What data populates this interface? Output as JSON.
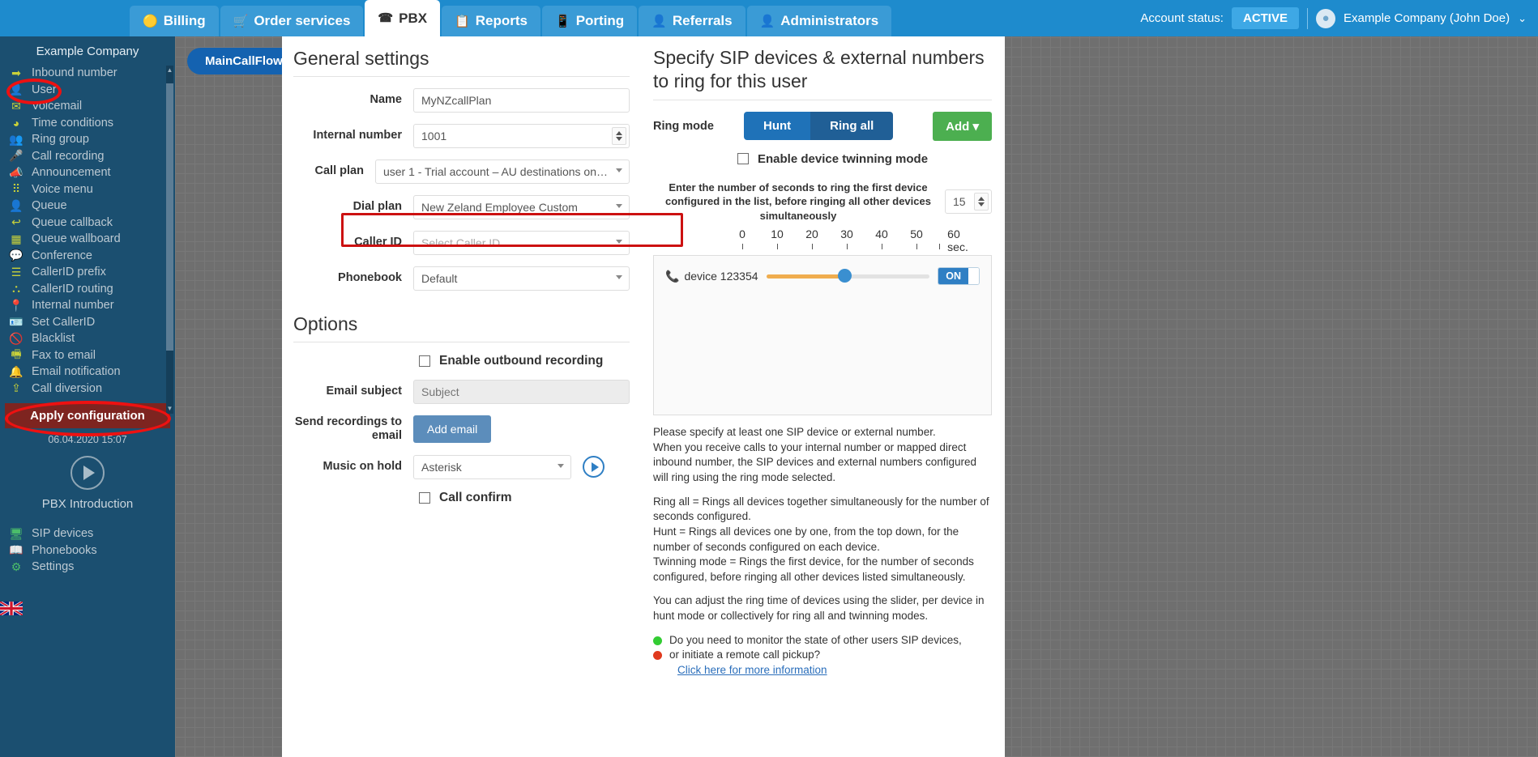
{
  "header": {
    "tabs": [
      {
        "label": "Billing",
        "icon": "wallet-icon",
        "active": false
      },
      {
        "label": "Order services",
        "icon": "cart-icon",
        "active": false
      },
      {
        "label": "PBX",
        "icon": "pbx-icon",
        "active": true
      },
      {
        "label": "Reports",
        "icon": "report-icon",
        "active": false
      },
      {
        "label": "Porting",
        "icon": "phone-icon",
        "active": false
      },
      {
        "label": "Referrals",
        "icon": "person-icon",
        "active": false
      },
      {
        "label": "Administrators",
        "icon": "admin-icon",
        "active": false
      }
    ],
    "account_status_label": "Account status:",
    "account_status_value": "ACTIVE",
    "user_name": "Example Company (John Doe)"
  },
  "sidebar": {
    "company": "Example Company",
    "items": [
      {
        "label": "Inbound number",
        "icon": "arrow-right-icon"
      },
      {
        "label": "User",
        "icon": "user-icon"
      },
      {
        "label": "Voicemail",
        "icon": "envelope-icon"
      },
      {
        "label": "Time conditions",
        "icon": "clock-icon"
      },
      {
        "label": "Ring group",
        "icon": "users-icon"
      },
      {
        "label": "Call recording",
        "icon": "microphone-icon"
      },
      {
        "label": "Announcement",
        "icon": "megaphone-icon"
      },
      {
        "label": "Voice menu",
        "icon": "grid-icon"
      },
      {
        "label": "Queue",
        "icon": "user-plus-icon"
      },
      {
        "label": "Queue callback",
        "icon": "reply-icon"
      },
      {
        "label": "Queue wallboard",
        "icon": "table-icon"
      },
      {
        "label": "Conference",
        "icon": "chat-icon"
      },
      {
        "label": "CallerID prefix",
        "icon": "list-icon"
      },
      {
        "label": "CallerID routing",
        "icon": "sitemap-icon"
      },
      {
        "label": "Internal number",
        "icon": "pin-icon"
      },
      {
        "label": "Set CallerID",
        "icon": "idcard-icon"
      },
      {
        "label": "Blacklist",
        "icon": "ban-icon"
      },
      {
        "label": "Fax to email",
        "icon": "fax-icon"
      },
      {
        "label": "Email notification",
        "icon": "bell-icon"
      },
      {
        "label": "Call diversion",
        "icon": "upload-icon"
      }
    ],
    "apply_button": "Apply configuration",
    "timestamp": "06.04.2020 15:07",
    "intro_label": "PBX Introduction",
    "footer_items": [
      {
        "label": "SIP devices",
        "icon": "monitor-icon"
      },
      {
        "label": "Phonebooks",
        "icon": "book-icon"
      },
      {
        "label": "Settings",
        "icon": "gear-icon"
      }
    ]
  },
  "flow": {
    "node_label": "MainCallFlow"
  },
  "general": {
    "title": "General settings",
    "name_label": "Name",
    "name_value": "MyNZcallPlan",
    "internal_label": "Internal number",
    "internal_value": "1001",
    "callplan_label": "Call plan",
    "callplan_value": "user 1 - Trial account – AU destinations on…",
    "dialplan_label": "Dial plan",
    "dialplan_value": "New Zeland Employee Custom",
    "callerid_label": "Caller ID",
    "callerid_placeholder": "Select Caller ID",
    "phonebook_label": "Phonebook",
    "phonebook_value": "Default"
  },
  "options": {
    "title": "Options",
    "outbound_recording_label": "Enable outbound recording",
    "email_subject_label": "Email subject",
    "email_subject_placeholder": "Subject",
    "send_recordings_label": "Send recordings to email",
    "add_email_button": "Add email",
    "moh_label": "Music on hold",
    "moh_value": "Asterisk",
    "call_confirm_label": "Call confirm"
  },
  "devices": {
    "title": "Specify SIP devices & external numbers to ring for this user",
    "ring_mode_label": "Ring mode",
    "mode_hunt": "Hunt",
    "mode_ring_all": "Ring all",
    "add_button": "Add",
    "twinning_label": "Enable device twinning mode",
    "seconds_note": "Enter the number of seconds to ring the first device configured in the list, before ringing all other devices simultaneously",
    "seconds_value": "15",
    "scale_ticks": [
      "0",
      "10",
      "20",
      "30",
      "40",
      "50",
      "60 sec."
    ],
    "device_name": "device 123354",
    "device_toggle": "ON",
    "slider_percent": 48
  },
  "help": {
    "p1": "Please specify at least one SIP device or external number.",
    "p2": "When you receive calls to your internal number or mapped direct inbound number, the SIP devices and external numbers configured will ring using the ring mode selected.",
    "p3": "Ring all = Rings all devices together simultaneously for the number of seconds configured.",
    "p4": "Hunt = Rings all devices one by one, from the top down, for the number of seconds configured on each device.",
    "p5": "Twinning mode = Rings the first device, for the number of seconds configured, before ringing all other devices listed simultaneously.",
    "p6": "You can adjust the ring time of devices using the slider, per device in hunt mode or collectively for ring all and twinning modes.",
    "bullet1": "Do you need to monitor the state of other users SIP devices,",
    "bullet2": "or initiate a remote call pickup?",
    "link": "Click here for more information",
    "green": "#33cc33",
    "red": "#e03a1e"
  }
}
